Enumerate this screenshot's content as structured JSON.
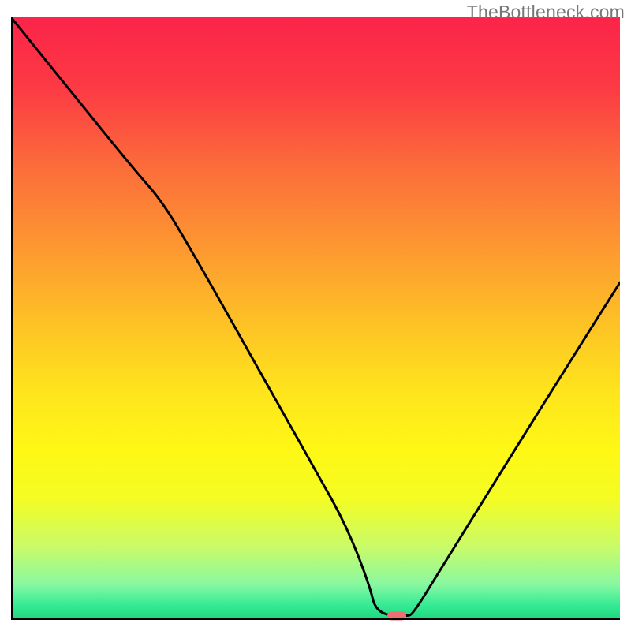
{
  "watermark": "TheBottleneck.com",
  "gradient_stops": [
    {
      "offset": 0.0,
      "color": "#fb2449"
    },
    {
      "offset": 0.12,
      "color": "#fc3b44"
    },
    {
      "offset": 0.25,
      "color": "#fc6d3a"
    },
    {
      "offset": 0.38,
      "color": "#fd9731"
    },
    {
      "offset": 0.5,
      "color": "#fdbf26"
    },
    {
      "offset": 0.62,
      "color": "#fee41d"
    },
    {
      "offset": 0.72,
      "color": "#fef815"
    },
    {
      "offset": 0.8,
      "color": "#f3fc24"
    },
    {
      "offset": 0.88,
      "color": "#c8fb6a"
    },
    {
      "offset": 0.94,
      "color": "#8af8a0"
    },
    {
      "offset": 0.975,
      "color": "#36eb96"
    },
    {
      "offset": 1.0,
      "color": "#1dd67b"
    }
  ],
  "axis_color": "#000000",
  "axis_width": 5,
  "curve_color": "#000000",
  "curve_width": 3,
  "marker": {
    "x_frac": 0.634,
    "y_frac": 0.994,
    "color": "#ed6f72"
  },
  "chart_data": {
    "type": "line",
    "title": "",
    "xlabel": "",
    "ylabel": "",
    "xlim": [
      0,
      1
    ],
    "ylim": [
      0,
      1
    ],
    "grid": false,
    "note": "Axes carry no tick labels in the source image; x and y are normalized fractions of the plot area (0 = left/bottom, 1 = right/top). The curve is a V-shaped dip with its minimum near x≈0.60–0.65 at y≈0. A small reddish pill marker sits at the bottom of the V.",
    "series": [
      {
        "name": "bottleneck-curve",
        "x": [
          0.0,
          0.1,
          0.2,
          0.248,
          0.3,
          0.4,
          0.5,
          0.55,
          0.588,
          0.6,
          0.65,
          0.66,
          0.7,
          0.8,
          0.9,
          1.0
        ],
        "y": [
          1.0,
          0.875,
          0.75,
          0.695,
          0.607,
          0.428,
          0.248,
          0.158,
          0.06,
          0.01,
          0.006,
          0.01,
          0.075,
          0.238,
          0.4,
          0.56
        ]
      }
    ],
    "marker_point": {
      "x": 0.634,
      "y": 0.006
    }
  }
}
